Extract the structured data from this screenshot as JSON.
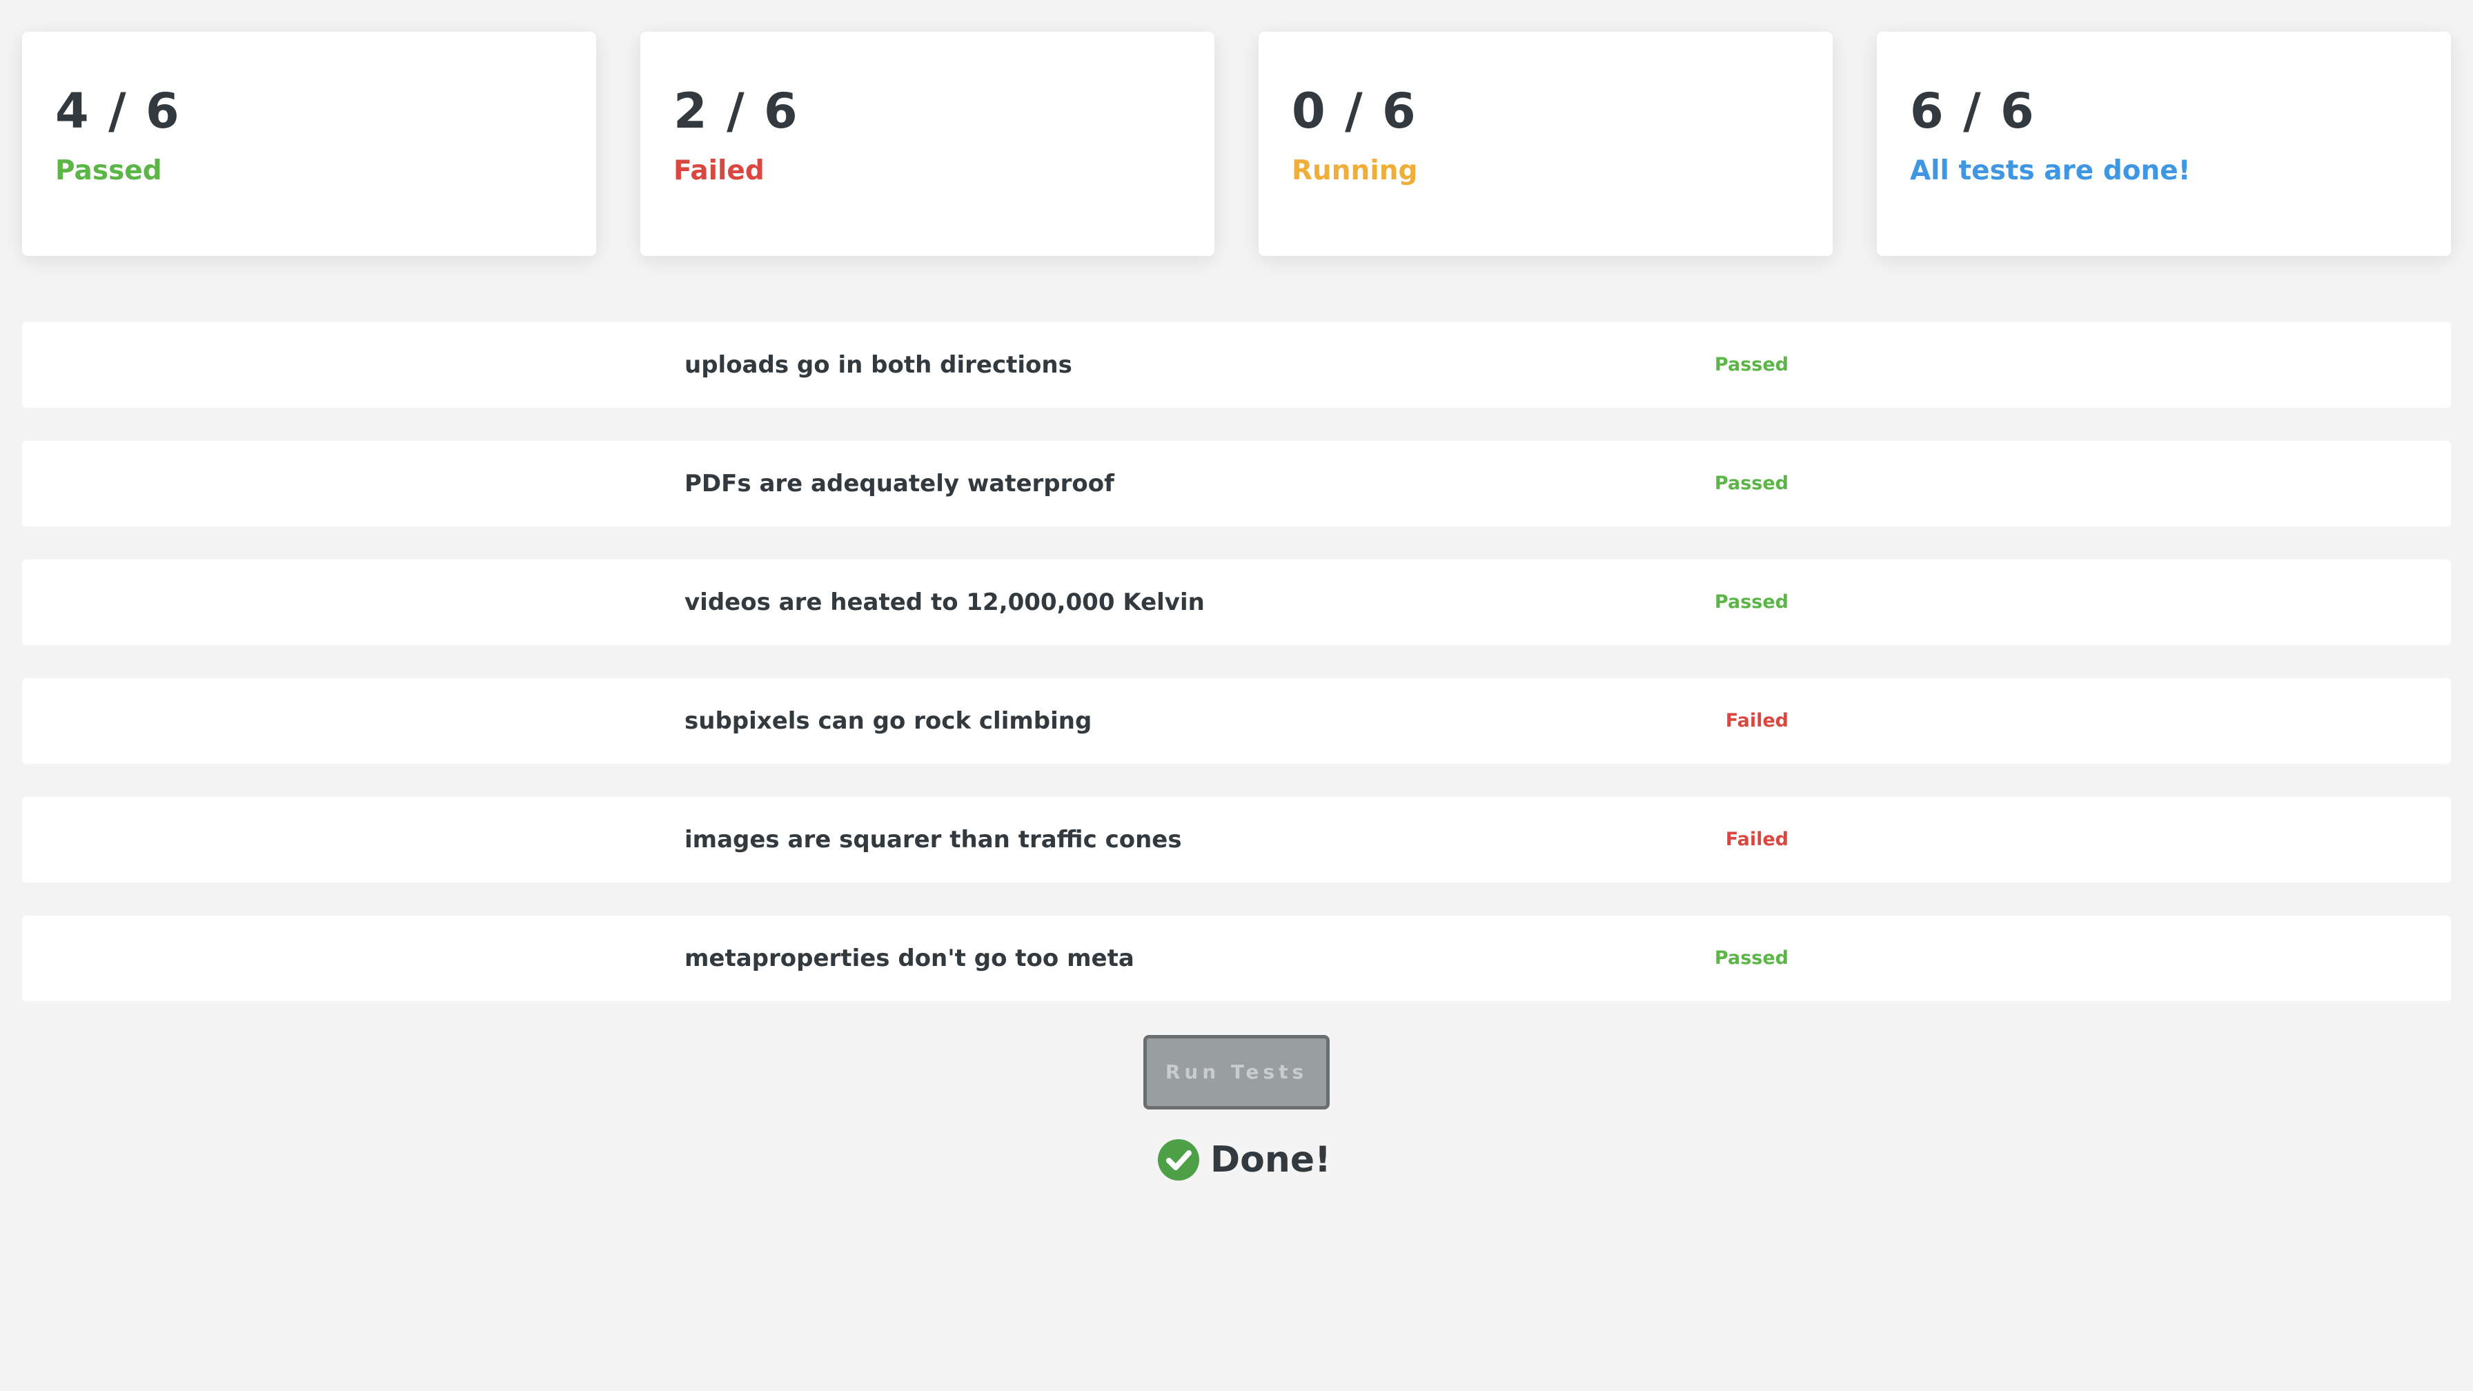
{
  "colors": {
    "passed": "#5cb547",
    "failed": "#d9473f",
    "running": "#efae3a",
    "done": "#3f96e2",
    "check": "#4ea047"
  },
  "summary": {
    "passed": {
      "count": "4 / 6",
      "label": "Passed"
    },
    "failed": {
      "count": "2 / 6",
      "label": "Failed"
    },
    "running": {
      "count": "0 / 6",
      "label": "Running"
    },
    "total": {
      "count": "6 / 6",
      "label": "All tests are done!"
    }
  },
  "tests": [
    {
      "name": "uploads go in both directions",
      "status": "Passed"
    },
    {
      "name": "PDFs are adequately waterproof",
      "status": "Passed"
    },
    {
      "name": "videos are heated to 12,000,000 Kelvin",
      "status": "Passed"
    },
    {
      "name": "subpixels can go rock climbing",
      "status": "Failed"
    },
    {
      "name": "images are squarer than traffic cones",
      "status": "Failed"
    },
    {
      "name": "metaproperties don't go too meta",
      "status": "Passed"
    }
  ],
  "run_button": {
    "label": "Run Tests"
  },
  "done": {
    "icon": "check-circle-icon",
    "label": "Done!"
  }
}
